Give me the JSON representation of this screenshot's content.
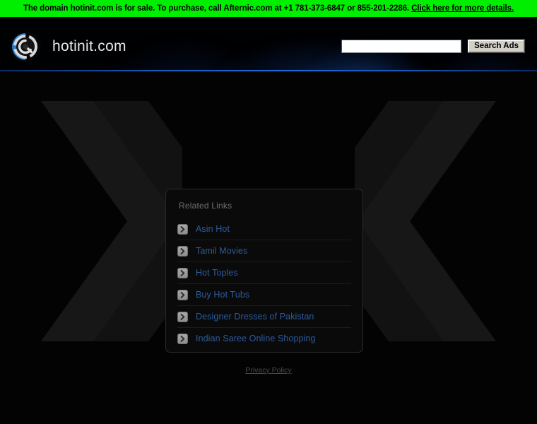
{
  "banner": {
    "text_before_link": "The domain hotinit.com is for sale. To purchase, call Afternic.com at +1 781-373-6847 or 855-201-2286. ",
    "link_text": "Click here for more details.",
    "background_color": "#00ee00",
    "text_color": "#000000"
  },
  "header": {
    "brand_name": "hotinit.com",
    "logo_icon": "circular-shutter-logo-icon",
    "rule_color": "#1d6ad6",
    "search": {
      "input_value": "",
      "placeholder": "",
      "button_label": "Search Ads"
    }
  },
  "main": {
    "related_panel": {
      "title": "Related Links",
      "links": [
        {
          "label": "Asin Hot",
          "icon": "chevron-right-icon"
        },
        {
          "label": "Tamil Movies",
          "icon": "chevron-right-icon"
        },
        {
          "label": "Hot Toples",
          "icon": "chevron-right-icon"
        },
        {
          "label": "Buy Hot Tubs",
          "icon": "chevron-right-icon"
        },
        {
          "label": "Designer Dresses of Pakistan",
          "icon": "chevron-right-icon"
        },
        {
          "label": "Indian Saree Online Shopping",
          "icon": "chevron-right-icon"
        }
      ],
      "link_color": "#2d5c9e",
      "title_color": "#6f6f6f"
    },
    "background": {
      "left_chevron_icon": "chevron-right-decorative-icon",
      "right_chevron_icon": "chevron-left-decorative-icon"
    }
  },
  "footer": {
    "privacy_label": "Privacy Policy"
  }
}
